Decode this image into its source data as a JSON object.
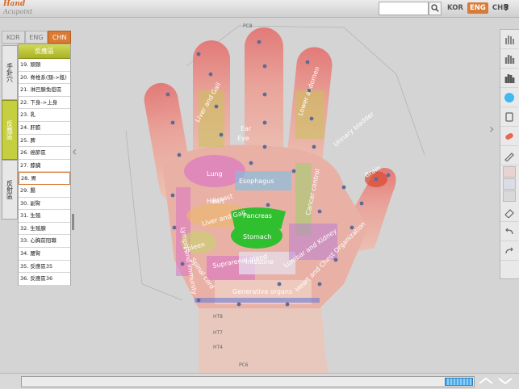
{
  "app": {
    "title_line1": "Hand",
    "title_line2": "Acupoint"
  },
  "search": {
    "placeholder": ""
  },
  "top_lang": [
    {
      "label": "KOR"
    },
    {
      "label": "ENG",
      "active": true
    },
    {
      "label": "CHN"
    }
  ],
  "help_label": "?",
  "left_lang": [
    {
      "label": "KOR"
    },
    {
      "label": "ENG"
    },
    {
      "label": "CHN",
      "active": true
    }
  ],
  "side_tabs": [
    {
      "label": "手針穴"
    },
    {
      "label": "反應區",
      "active": true
    },
    {
      "label": "反射區"
    }
  ],
  "list": {
    "header": "反應區",
    "items": [
      "19. 頭頸",
      "20. 脊椎系(頸->骶)",
      "21. 淋巴腺免疫區",
      "22. 下身->上身",
      "23. 乳",
      "24. 肝膽",
      "25. 脾",
      "26. 癌節區",
      "27. 膝臟",
      "28. 胃",
      "29. 腸",
      "30. 副腎",
      "31. 生殖",
      "32. 生殖腺",
      "33. 心胸前阻職",
      "34. 腰腎",
      "35. 反應區35",
      "36. 反應區36"
    ],
    "selected_index": 9
  },
  "hand": {
    "labels": [
      "Liver and Gall",
      "Lower abdomen",
      "Eye",
      "Ear",
      "Lung",
      "Heart",
      "Esophagus",
      "Cancer control",
      "Breast",
      "Liver and Gall",
      "Pancreas",
      "Stomach",
      "Spleen",
      "Lymph and immunity",
      "Spinal cord",
      "Suprarenal gland",
      "Intestine",
      "Lumbar and Kidney",
      "Heart and Chest Organization",
      "Generative organs",
      "Brain",
      "Urinary bladder"
    ],
    "point_codes": [
      "PC8",
      "HT8",
      "HT7",
      "HT4",
      "PC6"
    ]
  },
  "toolbar": {
    "tools": [
      "hand-outline-icon",
      "hand-filled-icon",
      "hand-dark-icon",
      "hand-blue-icon",
      "ring-icon",
      "band-icon",
      "pen-icon",
      "eraser-icon",
      "undo-icon",
      "redo-icon"
    ],
    "swatches": [
      "#e8d2d2",
      "#dcdce6",
      "#d9d9d9"
    ]
  },
  "colors": {
    "accent": "#d97a35",
    "tab_active": "#c6cf3f",
    "zone_green": "#2fbf2f"
  }
}
